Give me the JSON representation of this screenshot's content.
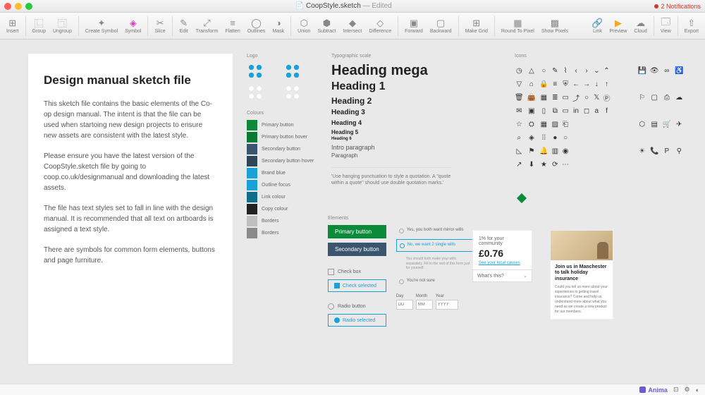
{
  "titlebar": {
    "filename": "CoopStyle.sketch",
    "status": "— Edited",
    "notifications": "2 Notifications"
  },
  "toolbar": {
    "insert": "Insert",
    "group": "Group",
    "ungroup": "Ungroup",
    "create_symbol": "Create Symbol",
    "symbol": "Symbol",
    "slice": "Slice",
    "edit": "Edit",
    "transform": "Transform",
    "flatten": "Flatten",
    "outlines": "Outlines",
    "mask": "Mask",
    "union": "Union",
    "subtract": "Subtract",
    "intersect": "Intersect",
    "difference": "Difference",
    "forward": "Forward",
    "backward": "Backward",
    "make_grid": "Make Grid",
    "round_to_pixel": "Round To Pixel",
    "show_pixels": "Show Pixels",
    "link": "Link",
    "preview": "Preview",
    "cloud": "Cloud",
    "view": "View",
    "export": "Export"
  },
  "info": {
    "title": "Design manual sketch file",
    "p1": "This sketch file contains the basic elements of the Co-op design manual. The intent is that the file can be used when startoing new design projects to ensure new assets are consistent with the latest style.",
    "p2": "Please ensure you have the latest version of the CoopStyle.sketch file by going to coop.co.uk/designmanual and downloading the latest assets.",
    "p3": "The file has text styles set to fall in line with the design manual. It is recommended that all text on artboards is assigned a text style.",
    "p4": "There are symbols for common form elements, buttons and page furniture."
  },
  "sections": {
    "logo": "Logo",
    "colours": "Colours",
    "typographic_scale": "Typographic scale",
    "elements": "Elements",
    "icons": "Icons"
  },
  "colours": [
    {
      "label": "Primary button",
      "hex": "#0b8a3a"
    },
    {
      "label": "Primary button hover",
      "hex": "#0a7a33"
    },
    {
      "label": "Secondary button",
      "hex": "#3b556f"
    },
    {
      "label": "Secondary button hover",
      "hex": "#2f4558"
    },
    {
      "label": "Brand blue",
      "hex": "#1aa1d8"
    },
    {
      "label": "Outline focus",
      "hex": "#1aa1d8"
    },
    {
      "label": "Link colour",
      "hex": "#0f6e8c"
    },
    {
      "label": "Copy colour",
      "hex": "#222222"
    },
    {
      "label": "Borders",
      "hex": "#bfbfbf"
    },
    {
      "label": "Borders",
      "hex": "#8a8a8a"
    }
  ],
  "type": {
    "mega": "Heading mega",
    "h1": "Heading 1",
    "h2": "Heading 2",
    "h3": "Heading 3",
    "h4": "Heading 4",
    "h5": "Heading 5",
    "h6": "Heading 6",
    "intro": "Intro paragraph",
    "para": "Paragraph",
    "quote": "'Use hanging punctuation to style a quotation. A \"quote within a quote\" should use double quotation marks.'"
  },
  "elements": {
    "primary": "Primary button",
    "secondary": "Secondary  button",
    "checkbox": "Check box",
    "check_selected": "Check selected",
    "radio": "Radio button",
    "radio_selected": "Radio selected",
    "opt1": "Yes, you both want mirror wills",
    "opt2": "No, we want 2 single wills",
    "opt_note": "You should both make your wills separately. Fill in the rest of this form just for yourself.",
    "opt3": "You're not sure",
    "day": "Day",
    "month": "Month",
    "year": "Year",
    "day_ph": "DD",
    "month_ph": "MM",
    "year_ph": "YYYY"
  },
  "reward": {
    "pct": "1% for your community",
    "amount": "£0.76",
    "link": "See your local causes",
    "dropdown": "What's this?"
  },
  "promo": {
    "title": "Join us in Manchester to talk holiday insurance",
    "body": "Could you tell us more about your experiences in getting travel insurance? Come and help us understand more about what you need as we create a new product for our members."
  },
  "bottombar": {
    "anima": "Anima"
  }
}
